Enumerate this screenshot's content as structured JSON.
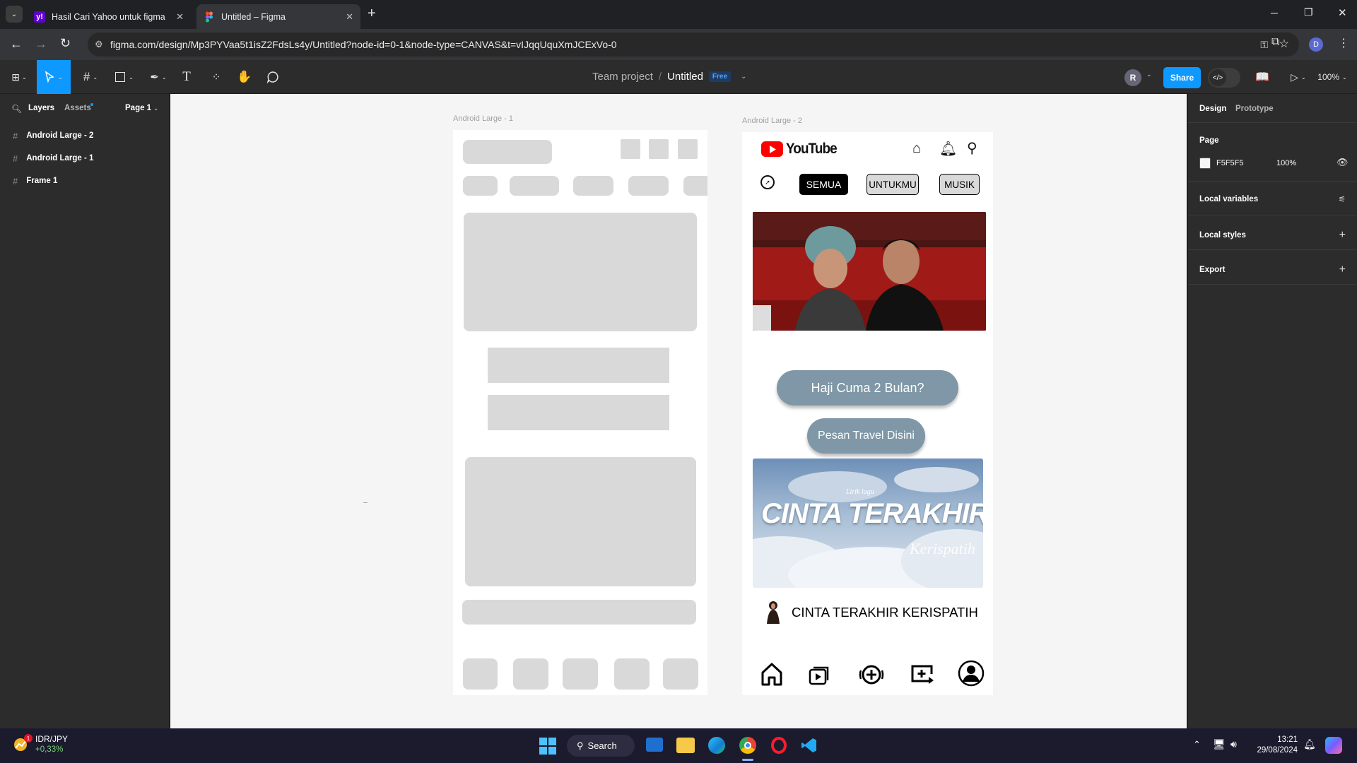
{
  "browser": {
    "tabs": [
      {
        "title": "Hasil Cari Yahoo untuk figma",
        "active": false
      },
      {
        "title": "Untitled – Figma",
        "active": true
      }
    ],
    "url": "figma.com/design/Mp3PYVaa5t1isZ2FdsLs4y/Untitled?node-id=0-1&node-type=CANVAS&t=vIJqqUquXmJCExVo-0",
    "profile_initial": "D"
  },
  "toolbar": {
    "project": "Team project",
    "separator": "/",
    "file": "Untitled",
    "plan_badge": "Free",
    "avatar_initial": "R",
    "share_label": "Share",
    "zoom": "100%"
  },
  "left_panel": {
    "tabs": [
      "Layers",
      "Assets"
    ],
    "page": "Page 1",
    "layers": [
      "Android Large - 2",
      "Android Large - 1",
      "Frame 1"
    ]
  },
  "right_panel": {
    "tabs": [
      "Design",
      "Prototype"
    ],
    "page_label": "Page",
    "page_color": "F5F5F5",
    "page_color_hex": "#F5F5F5",
    "page_opacity": "100%",
    "sections": [
      "Local variables",
      "Local styles",
      "Export"
    ]
  },
  "frames": {
    "frame1_label": "Android Large - 1",
    "frame2_label": "Android Large - 2"
  },
  "youtube": {
    "brand": "YouTube",
    "chips": [
      "SEMUA",
      "UNTUKMU",
      "MUSIK"
    ],
    "button_primary": "Haji Cuma 2 Bulan?",
    "button_secondary": "Pesan Travel Disini",
    "thumb_small": "Lirik lagu",
    "thumb_title": "CINTA TERAKHIR",
    "thumb_script": "Kerispatih",
    "video_title": "CINTA TERAKHIR KERISPATIH",
    "colors": {
      "red": "#ff0000",
      "button": "#7f97a6"
    }
  },
  "taskbar": {
    "stock_name": "IDR/JPY",
    "stock_change": "+0,33%",
    "search_label": "Search",
    "time": "13:21",
    "date": "29/08/2024",
    "help": "?"
  }
}
